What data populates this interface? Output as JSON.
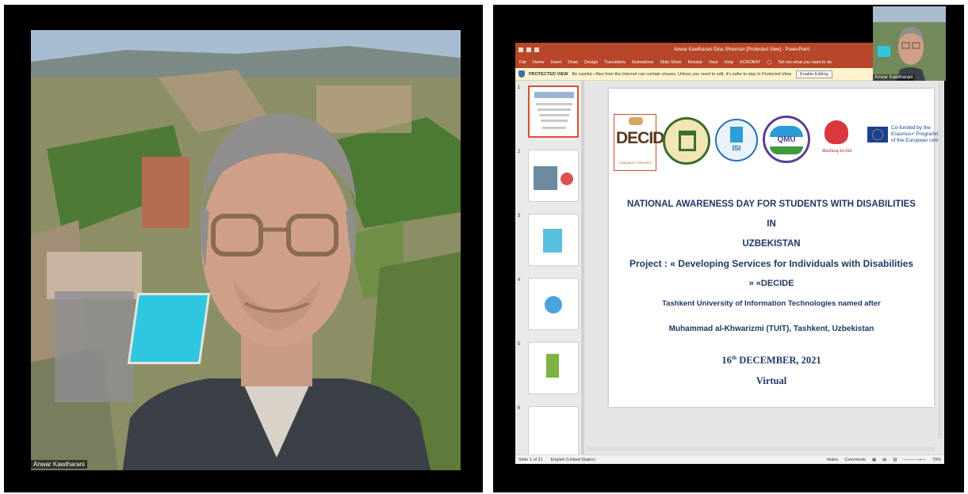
{
  "left_tile": {
    "participant_name": "Anwar Kawtharani"
  },
  "right_tile": {
    "pip_participant_name": "Anwar Kawtharani",
    "powerpoint": {
      "window_title": "Anwar Kawtharani Dina Shouman [Protected View] - PowerPoint",
      "menu_items": [
        "File",
        "Home",
        "Insert",
        "Draw",
        "Design",
        "Transitions",
        "Animations",
        "Slide Show",
        "Review",
        "View",
        "Help",
        "ACROBAT"
      ],
      "tell_me": "Tell me what you want to do",
      "protected_view_label": "PROTECTED VIEW",
      "protected_view_message": "Be careful—files from the Internet can contain viruses. Unless you need to edit, it's safer to stay in Protected View.",
      "enable_editing_label": "Enable Editing",
      "thumbnail_numbers": [
        "1",
        "2",
        "3",
        "4",
        "5",
        "6"
      ],
      "status_slide": "Slide 1 of 21",
      "status_language": "English (United States)",
      "status_notes": "Notes",
      "status_comments": "Comments",
      "status_zoom": "79%"
    },
    "slide": {
      "logo_decide": "DECIDE",
      "logo_decide_sub": "ERASMUS+ PROJECT",
      "logo_isi": "ISI",
      "logo_qmu": "QMU",
      "logo_mushtaq": "Mushtoq ko'zlar",
      "eu_caption_line1": "Co-funded by the",
      "eu_caption_line2": "Erasmus+ Programme",
      "eu_caption_line3": "of the European Union",
      "title_line1": "NATIONAL AWARENESS DAY FOR STUDENTS WITH DISABILITIES",
      "title_line2": "IN",
      "title_line3": "UZBEKISTAN",
      "project_line": "Project : « Developing Services for Individuals with Disabilities",
      "project_line2": "» «DECIDE",
      "university_line1": "Tashkent University of Information Technologies named after",
      "university_line2": "Muhammad al-Khwarizmi (TUIT), Tashkent, Uzbekistan",
      "date_day": "16",
      "date_sup": "th",
      "date_rest": " DECEMBER, 2021",
      "mode": "Virtual"
    }
  },
  "colors": {
    "ppt_accent": "#b7472a",
    "slide_text": "#1f3864",
    "pool": "#2fc7e0"
  }
}
